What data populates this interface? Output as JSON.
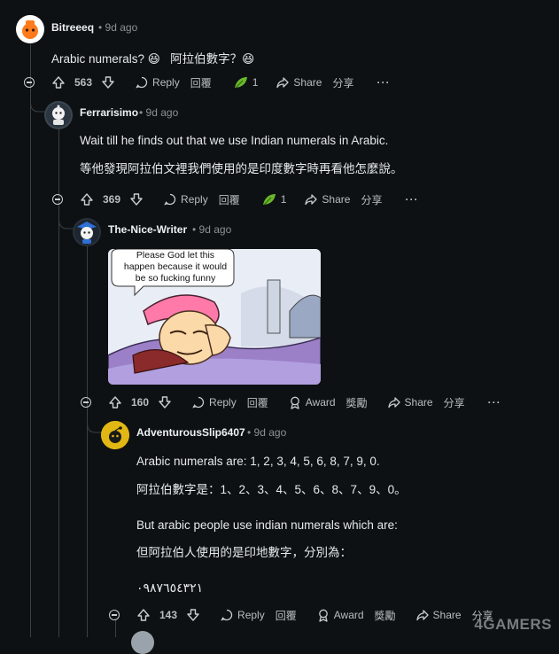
{
  "comments": [
    {
      "author": "Bitreeeq",
      "time": "• 9d ago",
      "lines": [
        "Arabic numerals? 😆   阿拉伯數字？😆"
      ],
      "votes": "563",
      "reply": "Reply",
      "reply_zh": "回覆",
      "award_count": "1",
      "share": "Share",
      "share_zh": "分享",
      "more": "···"
    },
    {
      "author": "Ferrarisimo",
      "time": "• 9d ago",
      "lines": [
        "Wait till he finds out that we use Indian numerals in Arabic.",
        "等他發現阿拉伯文裡我們使用的是印度數字時再看他怎麼說。"
      ],
      "votes": "369",
      "reply": "Reply",
      "reply_zh": "回覆",
      "award_count": "1",
      "share": "Share",
      "share_zh": "分享",
      "more": "···"
    },
    {
      "author": "The-Nice-Writer",
      "time": "• 9d ago",
      "meme_caption": [
        "Please God let this",
        "happen because it would",
        "be so fucking funny"
      ],
      "votes": "160",
      "reply": "Reply",
      "reply_zh": "回覆",
      "award": "Award",
      "award_zh": "獎勵",
      "share": "Share",
      "share_zh": "分享",
      "more": "···"
    },
    {
      "author": "AdventurousSlip6407",
      "time": "• 9d ago",
      "lines": [
        "Arabic numerals are: 1, 2, 3, 4, 5, 6, 8, 7, 9, 0.",
        "阿拉伯數字是：1、2、3、4、5、6、8、7、9、0。",
        "But arabic people use indian numerals which are:",
        "但阿拉伯人使用的是印地數字，分別為：",
        "٠٩٨٧٦٥٤٣٢١"
      ],
      "votes": "143",
      "reply": "Reply",
      "reply_zh": "回覆",
      "award": "Award",
      "award_zh": "獎勵",
      "share": "Share",
      "share_zh": "分享"
    }
  ],
  "watermark": "4GAMERS",
  "colors": {
    "background": "#0e1113",
    "thread_line": "#3a3f44",
    "text": "#e6e9eb",
    "muted": "#8a9297"
  }
}
